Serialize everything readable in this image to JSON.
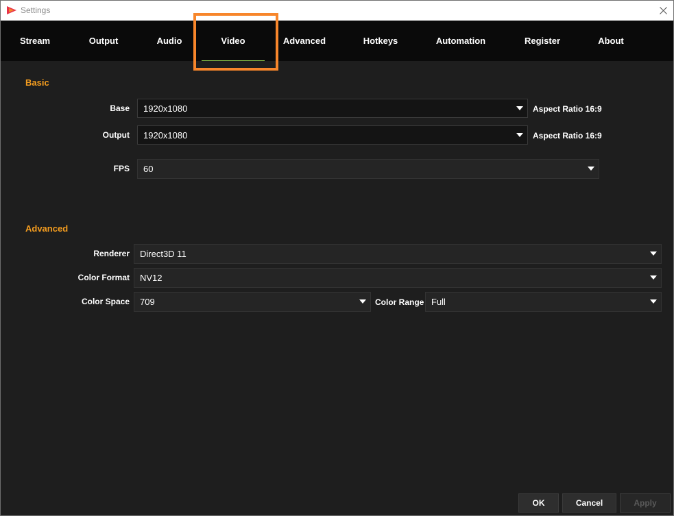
{
  "window": {
    "title": "Settings"
  },
  "tabs": [
    {
      "label": "Stream"
    },
    {
      "label": "Output"
    },
    {
      "label": "Audio"
    },
    {
      "label": "Video",
      "active": true
    },
    {
      "label": "Advanced"
    },
    {
      "label": "Hotkeys"
    },
    {
      "label": "Automation"
    },
    {
      "label": "Register"
    },
    {
      "label": "About"
    }
  ],
  "basic": {
    "title": "Basic",
    "base": {
      "label": "Base",
      "value": "1920x1080",
      "aspect": "Aspect Ratio 16:9"
    },
    "output": {
      "label": "Output",
      "value": "1920x1080",
      "aspect": "Aspect Ratio 16:9"
    },
    "fps": {
      "label": "FPS",
      "value": "60"
    }
  },
  "advanced": {
    "title": "Advanced",
    "renderer": {
      "label": "Renderer",
      "value": "Direct3D 11"
    },
    "color_format": {
      "label": "Color Format",
      "value": "NV12"
    },
    "color_space": {
      "label": "Color Space",
      "value": "709"
    },
    "color_range": {
      "label": "Color Range",
      "value": "Full"
    }
  },
  "buttons": {
    "ok": "OK",
    "cancel": "Cancel",
    "apply": "Apply"
  },
  "colors": {
    "accent_orange": "#f39c1f",
    "highlight_box": "#f7862b",
    "active_underline": "#8bc34a"
  }
}
